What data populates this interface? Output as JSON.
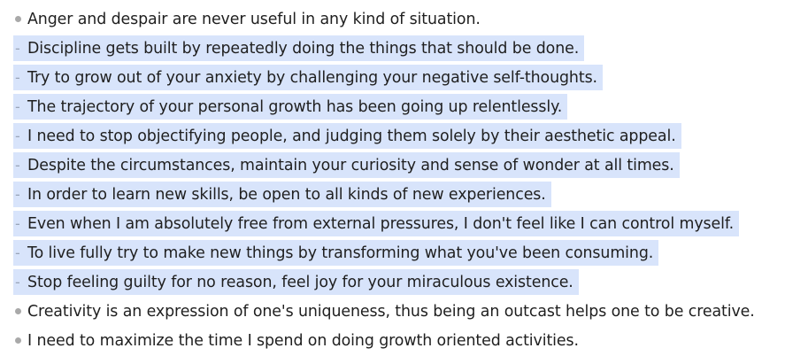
{
  "list": {
    "items": [
      {
        "text": "Anger and despair are never useful in any kind of situation.",
        "selected": false,
        "marker": "•"
      },
      {
        "text": "Discipline gets built by repeatedly doing the things that should be done.",
        "selected": true,
        "marker": "-"
      },
      {
        "text": "Try to grow out of your anxiety by challenging your negative self-thoughts.",
        "selected": true,
        "marker": "-"
      },
      {
        "text": "The trajectory of your personal growth has been going up relentlessly.",
        "selected": true,
        "marker": "-"
      },
      {
        "text": "I need to stop objectifying people, and judging them solely by their aesthetic appeal.",
        "selected": true,
        "marker": "-"
      },
      {
        "text": "Despite the circumstances, maintain your curiosity and sense of wonder at all times.",
        "selected": true,
        "marker": "-"
      },
      {
        "text": "In order to learn new skills, be open to all kinds of new experiences.",
        "selected": true,
        "marker": "-"
      },
      {
        "text": "Even when I am absolutely free from external pressures, I don't feel like I can control myself.",
        "selected": true,
        "marker": "-"
      },
      {
        "text": "To live fully try to make new things by transforming what you've been consuming.",
        "selected": true,
        "marker": "-"
      },
      {
        "text": "Stop feeling guilty for no reason, feel joy for your miraculous existence.",
        "selected": true,
        "marker": "-"
      },
      {
        "text": "Creativity is an expression of one's uniqueness, thus being an outcast helps one to be creative.",
        "selected": false,
        "marker": "•"
      },
      {
        "text": "I need to maximize the time I spend on doing growth oriented activities.",
        "selected": false,
        "marker": "•"
      }
    ]
  },
  "colors": {
    "selection": "#d8e4fb",
    "text": "#1f1f1f",
    "bullet": "#a9a9a9"
  }
}
